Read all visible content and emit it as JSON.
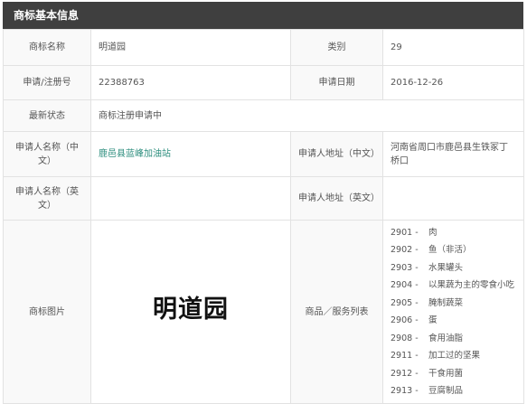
{
  "header": {
    "title": "商标基本信息"
  },
  "rows": {
    "name": {
      "label": "商标名称",
      "value": "明道园"
    },
    "category": {
      "label": "类别",
      "value": "29"
    },
    "reg_no": {
      "label": "申请/注册号",
      "value": "22388763"
    },
    "apply_date": {
      "label": "申请日期",
      "value": "2016-12-26"
    },
    "status": {
      "label": "最新状态",
      "value": "商标注册申请中"
    },
    "applicant_cn": {
      "label": "申请人名称（中文）",
      "value": "鹿邑县蓝峰加油站"
    },
    "address_cn": {
      "label": "申请人地址（中文）",
      "value": "河南省周口市鹿邑县生铁冢丁桥口"
    },
    "applicant_en": {
      "label": "申请人名称（英文）",
      "value": ""
    },
    "address_en": {
      "label": "申请人地址（英文）",
      "value": ""
    },
    "image": {
      "label": "商标图片",
      "value": "明道园"
    },
    "goods": {
      "label": "商品／服务列表",
      "items": [
        {
          "code": "2901 -",
          "name": "肉"
        },
        {
          "code": "2902 -",
          "name": "鱼（非活）"
        },
        {
          "code": "2903 -",
          "name": "水果罐头"
        },
        {
          "code": "2904 -",
          "name": "以果蔬为主的零食小吃"
        },
        {
          "code": "2905 -",
          "name": "腌制蔬菜"
        },
        {
          "code": "2906 -",
          "name": "蛋"
        },
        {
          "code": "2908 -",
          "name": "食用油脂"
        },
        {
          "code": "2911 -",
          "name": "加工过的坚果"
        },
        {
          "code": "2912 -",
          "name": "干食用菌"
        },
        {
          "code": "2913 -",
          "name": "豆腐制品"
        }
      ]
    }
  },
  "colors": {
    "header_bg": "#3f3f3f",
    "link": "#2f8f7f",
    "border": "#e2e2e2"
  }
}
